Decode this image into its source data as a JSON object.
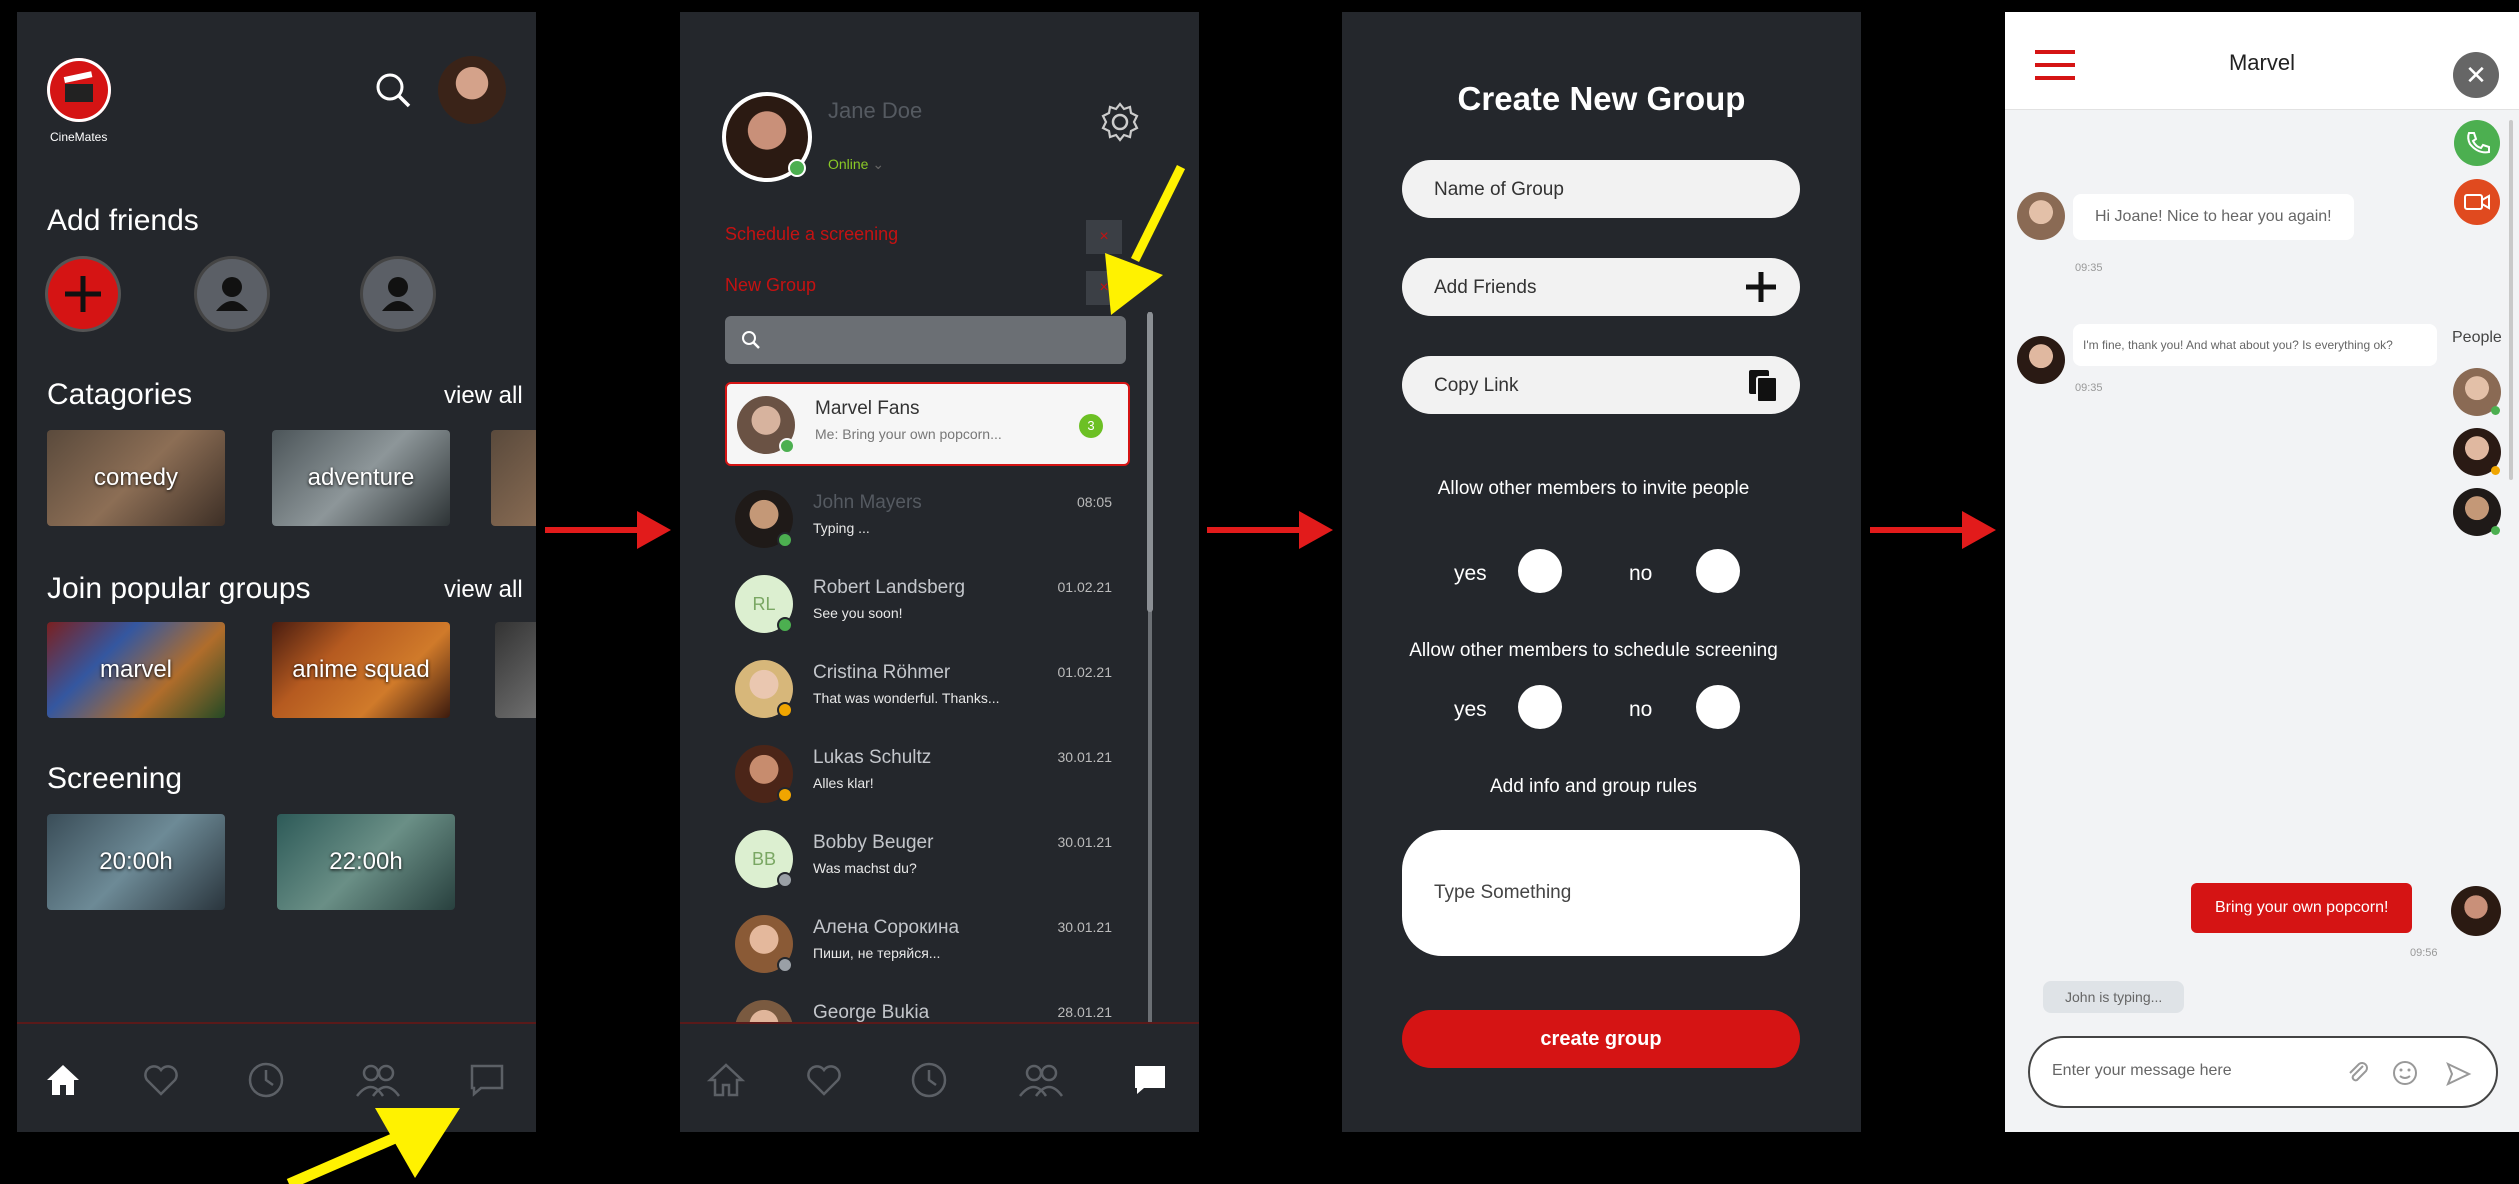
{
  "screen1": {
    "logo_text": "CineMates",
    "add_friends_title": "Add friends",
    "categories_title": "Catagories",
    "view_all_1": "view all",
    "categories": [
      {
        "label": "comedy"
      },
      {
        "label": "adventure"
      }
    ],
    "groups_title": "Join popular groups",
    "view_all_2": "view all",
    "groups": [
      {
        "label": "marvel"
      },
      {
        "label": "anime squad"
      }
    ],
    "screening_title": "Screening",
    "screenings": [
      {
        "label": "20:00h"
      },
      {
        "label": "22:00h"
      }
    ],
    "nav": [
      "home-icon",
      "heart-icon",
      "clock-icon",
      "group-icon",
      "chat-icon"
    ]
  },
  "screen2": {
    "user_name": "Jane Doe",
    "status": "Online",
    "menu_schedule": "Schedule a screening",
    "menu_new_group": "New Group",
    "chats": [
      {
        "name": "Marvel Fans",
        "preview": "Me: Bring your own popcorn...",
        "time": "",
        "badge": "3",
        "dot": "#4caf50"
      },
      {
        "name": "John Mayers",
        "preview": "Typing ...",
        "time": "08:05",
        "dot": "#4caf50"
      },
      {
        "name": "Robert Landsberg",
        "preview": "See you soon!",
        "time": "01.02.21",
        "initials": "RL",
        "dot": "#4caf50"
      },
      {
        "name": "Cristina Röhmer",
        "preview": "That was wonderful. Thanks...",
        "time": "01.02.21",
        "dot": "#f0a500"
      },
      {
        "name": "Lukas Schultz",
        "preview": "Alles klar!",
        "time": "30.01.21",
        "dot": "#f0a500"
      },
      {
        "name": "Bobby Beuger",
        "preview": "Was machst du?",
        "time": "30.01.21",
        "initials": "BB",
        "dot": "#9aa0a6"
      },
      {
        "name": "Алена Сорокина",
        "preview": "Пиши, не теряйся...",
        "time": "30.01.21",
        "dot": "#9aa0a6"
      },
      {
        "name": "George Bukia",
        "preview": "",
        "time": "28.01.21",
        "dot": "#9aa0a6"
      }
    ]
  },
  "screen3": {
    "title": "Create New Group",
    "name_placeholder": "Name of Group",
    "add_friends": "Add Friends",
    "copy_link": "Copy Link",
    "q1": "Allow other members to invite people",
    "q2": "Allow other members to schedule screening",
    "yes": "yes",
    "no": "no",
    "q3": "Add info and group rules",
    "textarea_placeholder": "Type Something",
    "create_button": "create group"
  },
  "screen4": {
    "title": "Marvel",
    "msg1": "Hi Joane! Nice to hear you again!",
    "time1": "09:35",
    "msg2": "I'm fine, thank you! And what about you? Is everything ok?",
    "time2": "09:35",
    "people_label": "People",
    "msg3": "Bring your own popcorn!",
    "time3": "09:56",
    "typing": "John is typing...",
    "input_placeholder": "Enter your message here"
  },
  "colors": {
    "accent": "#d51414",
    "bg_dark": "#24272c",
    "online": "#4caf50"
  }
}
